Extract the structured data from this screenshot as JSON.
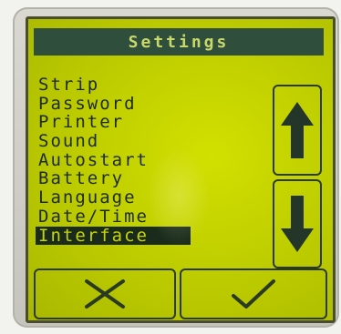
{
  "header": {
    "title": "Settings"
  },
  "menu": {
    "items": [
      {
        "label": "Strip"
      },
      {
        "label": "Password"
      },
      {
        "label": "Printer"
      },
      {
        "label": "Sound"
      },
      {
        "label": "Autostart"
      },
      {
        "label": "Battery"
      },
      {
        "label": "Language"
      },
      {
        "label": "Date/Time"
      },
      {
        "label": "Interface"
      }
    ],
    "selected_index": 8
  },
  "buttons": {
    "up": {
      "icon": "arrow-up-icon"
    },
    "down": {
      "icon": "arrow-down-icon"
    },
    "cancel": {
      "icon": "x-icon"
    },
    "confirm": {
      "icon": "checkmark-icon"
    }
  },
  "colors": {
    "screen": "#c3d200",
    "title_bar": "#2f4e3c",
    "text": "#1d2b1c"
  }
}
